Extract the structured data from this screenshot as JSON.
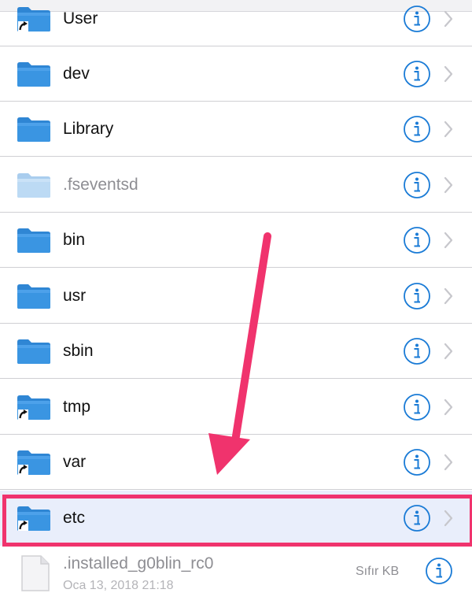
{
  "colors": {
    "accent": "#1a7bd6",
    "annotation": "#f0336d",
    "folder": "#3a95e2",
    "highlight_bg": "#e9eefb"
  },
  "rows": [
    {
      "name": "User",
      "icon": "folder-alias-icon",
      "dim": false
    },
    {
      "name": "dev",
      "icon": "folder-icon",
      "dim": false
    },
    {
      "name": "Library",
      "icon": "folder-icon",
      "dim": false
    },
    {
      "name": ".fseventsd",
      "icon": "folder-icon",
      "dim": true
    },
    {
      "name": "bin",
      "icon": "folder-icon",
      "dim": false
    },
    {
      "name": "usr",
      "icon": "folder-icon",
      "dim": false
    },
    {
      "name": "sbin",
      "icon": "folder-icon",
      "dim": false
    },
    {
      "name": "tmp",
      "icon": "folder-alias-icon",
      "dim": false
    },
    {
      "name": "var",
      "icon": "folder-alias-icon",
      "dim": false
    },
    {
      "name": "etc",
      "icon": "folder-alias-icon",
      "dim": false,
      "highlighted": true
    }
  ],
  "file": {
    "name": ".installed_g0blin_rc0",
    "date": "Oca 13, 2018 21:18",
    "size": "Sıfır KB",
    "icon": "document-icon"
  }
}
